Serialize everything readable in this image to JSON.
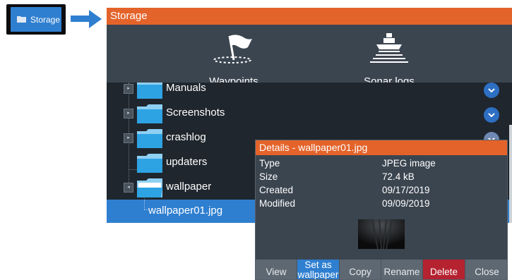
{
  "sidebar": {
    "storage_button_label": "Storage",
    "icon": "folder-icon"
  },
  "window": {
    "title": "Storage",
    "tiles": [
      {
        "label": "Waypoints",
        "icon": "waypoint-flag-icon"
      },
      {
        "label": "Sonar logs",
        "icon": "sonar-boat-icon"
      }
    ],
    "tree": [
      {
        "label": "Manuals",
        "expander": "▸",
        "icon": "folder-icon"
      },
      {
        "label": "Screenshots",
        "expander": "▸",
        "icon": "folder-icon"
      },
      {
        "label": "crashlog",
        "expander": "▸",
        "icon": "folder-icon"
      },
      {
        "label": "updaters",
        "expander": "",
        "icon": "folder-icon"
      },
      {
        "label": "wallpaper",
        "expander": "◂",
        "icon": "open-folder-icon"
      },
      {
        "label": "wallpaper01.jpg",
        "selected": true
      }
    ]
  },
  "details": {
    "title": "Details - wallpaper01.jpg",
    "rows": [
      {
        "key": "Type",
        "value": "JPEG image"
      },
      {
        "key": "Size",
        "value": "72.4 kB"
      },
      {
        "key": "Created",
        "value": "09/17/2019"
      },
      {
        "key": "Modified",
        "value": "09/09/2019"
      }
    ],
    "actions": {
      "view": "View",
      "set_wallpaper_1": "Set as",
      "set_wallpaper_2": "wallpaper",
      "copy": "Copy",
      "rename": "Rename",
      "delete": "Delete",
      "close": "Close"
    }
  },
  "colors": {
    "accent": "#e4632a",
    "selection": "#2f7fd0",
    "delete": "#b52230",
    "panel": "#3b4550"
  }
}
